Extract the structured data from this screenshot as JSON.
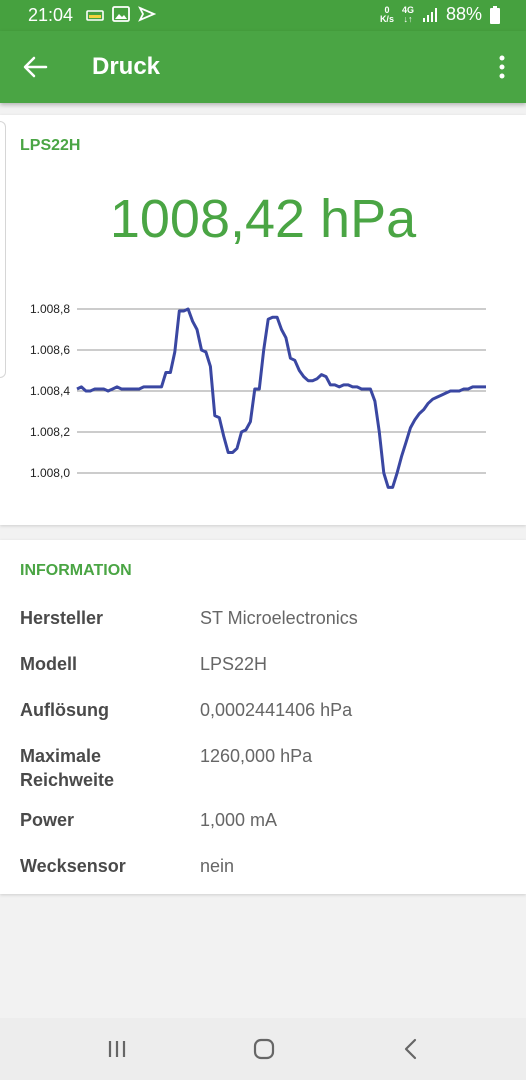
{
  "status_bar": {
    "time": "21:04",
    "net_speed_value": "0",
    "net_speed_unit": "K/s",
    "network_type": "4G",
    "battery": "88%"
  },
  "app_bar": {
    "title": "Druck"
  },
  "sensor": {
    "name": "LPS22H",
    "current_value": "1008,42 hPa"
  },
  "chart_data": {
    "type": "line",
    "ylim": [
      1007.9,
      1008.85
    ],
    "y_ticks": [
      {
        "value": 1008.0,
        "label": "1.008,0"
      },
      {
        "value": 1008.2,
        "label": "1.008,2"
      },
      {
        "value": 1008.4,
        "label": "1.008,4"
      },
      {
        "value": 1008.6,
        "label": "1.008,6"
      },
      {
        "value": 1008.8,
        "label": "1.008,8"
      }
    ],
    "series": [
      {
        "color": "#3a47a2",
        "values": [
          1008.41,
          1008.42,
          1008.4,
          1008.4,
          1008.41,
          1008.41,
          1008.41,
          1008.4,
          1008.41,
          1008.42,
          1008.41,
          1008.41,
          1008.41,
          1008.41,
          1008.41,
          1008.42,
          1008.42,
          1008.42,
          1008.42,
          1008.42,
          1008.49,
          1008.49,
          1008.59,
          1008.79,
          1008.79,
          1008.8,
          1008.74,
          1008.7,
          1008.6,
          1008.59,
          1008.52,
          1008.28,
          1008.27,
          1008.18,
          1008.1,
          1008.1,
          1008.12,
          1008.2,
          1008.21,
          1008.25,
          1008.41,
          1008.41,
          1008.6,
          1008.75,
          1008.76,
          1008.76,
          1008.7,
          1008.66,
          1008.56,
          1008.55,
          1008.5,
          1008.47,
          1008.45,
          1008.45,
          1008.46,
          1008.48,
          1008.47,
          1008.43,
          1008.43,
          1008.42,
          1008.43,
          1008.43,
          1008.42,
          1008.42,
          1008.41,
          1008.41,
          1008.41,
          1008.35,
          1008.2,
          1008.0,
          1007.93,
          1007.93,
          1008.0,
          1008.08,
          1008.15,
          1008.22,
          1008.26,
          1008.29,
          1008.31,
          1008.34,
          1008.36,
          1008.37,
          1008.38,
          1008.39,
          1008.4,
          1008.4,
          1008.4,
          1008.41,
          1008.41,
          1008.42,
          1008.42,
          1008.42,
          1008.42
        ]
      }
    ],
    "grid": true
  },
  "information": {
    "title": "INFORMATION",
    "rows": [
      {
        "label": "Hersteller",
        "value": "ST Microelectronics"
      },
      {
        "label": "Modell",
        "value": "LPS22H"
      },
      {
        "label": "Auflösung",
        "value": "0,0002441406 hPa"
      },
      {
        "label": "Maximale Reichweite",
        "value": "1260,000 hPa"
      },
      {
        "label": "Power",
        "value": "1,000 mA"
      },
      {
        "label": "Wecksensor",
        "value": "nein"
      }
    ]
  },
  "colors": {
    "accent": "#4aa544",
    "line": "#3a47a2"
  }
}
